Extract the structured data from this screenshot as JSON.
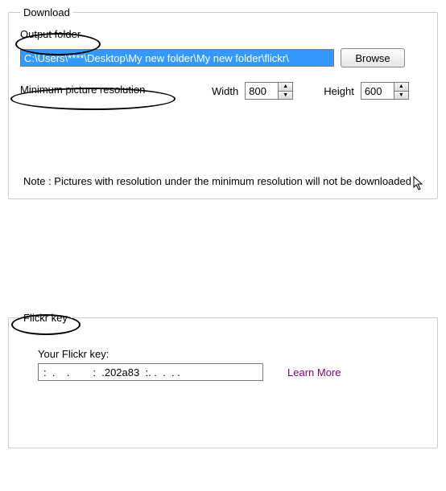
{
  "download": {
    "legend": "Download",
    "output_folder_label": "Output folder",
    "output_folder_value": "C:\\Users\\****\\Desktop\\My new folder\\My new folder\\flickr\\",
    "browse_label": "Browse",
    "min_res_label": "Minimum picture resolution",
    "width_label": "Width",
    "width_value": "800",
    "height_label": "Height",
    "height_value": "600",
    "note": "Note : Pictures with resolution under the minimum resolution will not be downloaded"
  },
  "flickr": {
    "legend": "Flickr key",
    "your_key_label": "Your Flickr key:",
    "key_value": ":  .    .        :  .202a83  :. .  .  . .",
    "learn_more": "Learn More"
  }
}
